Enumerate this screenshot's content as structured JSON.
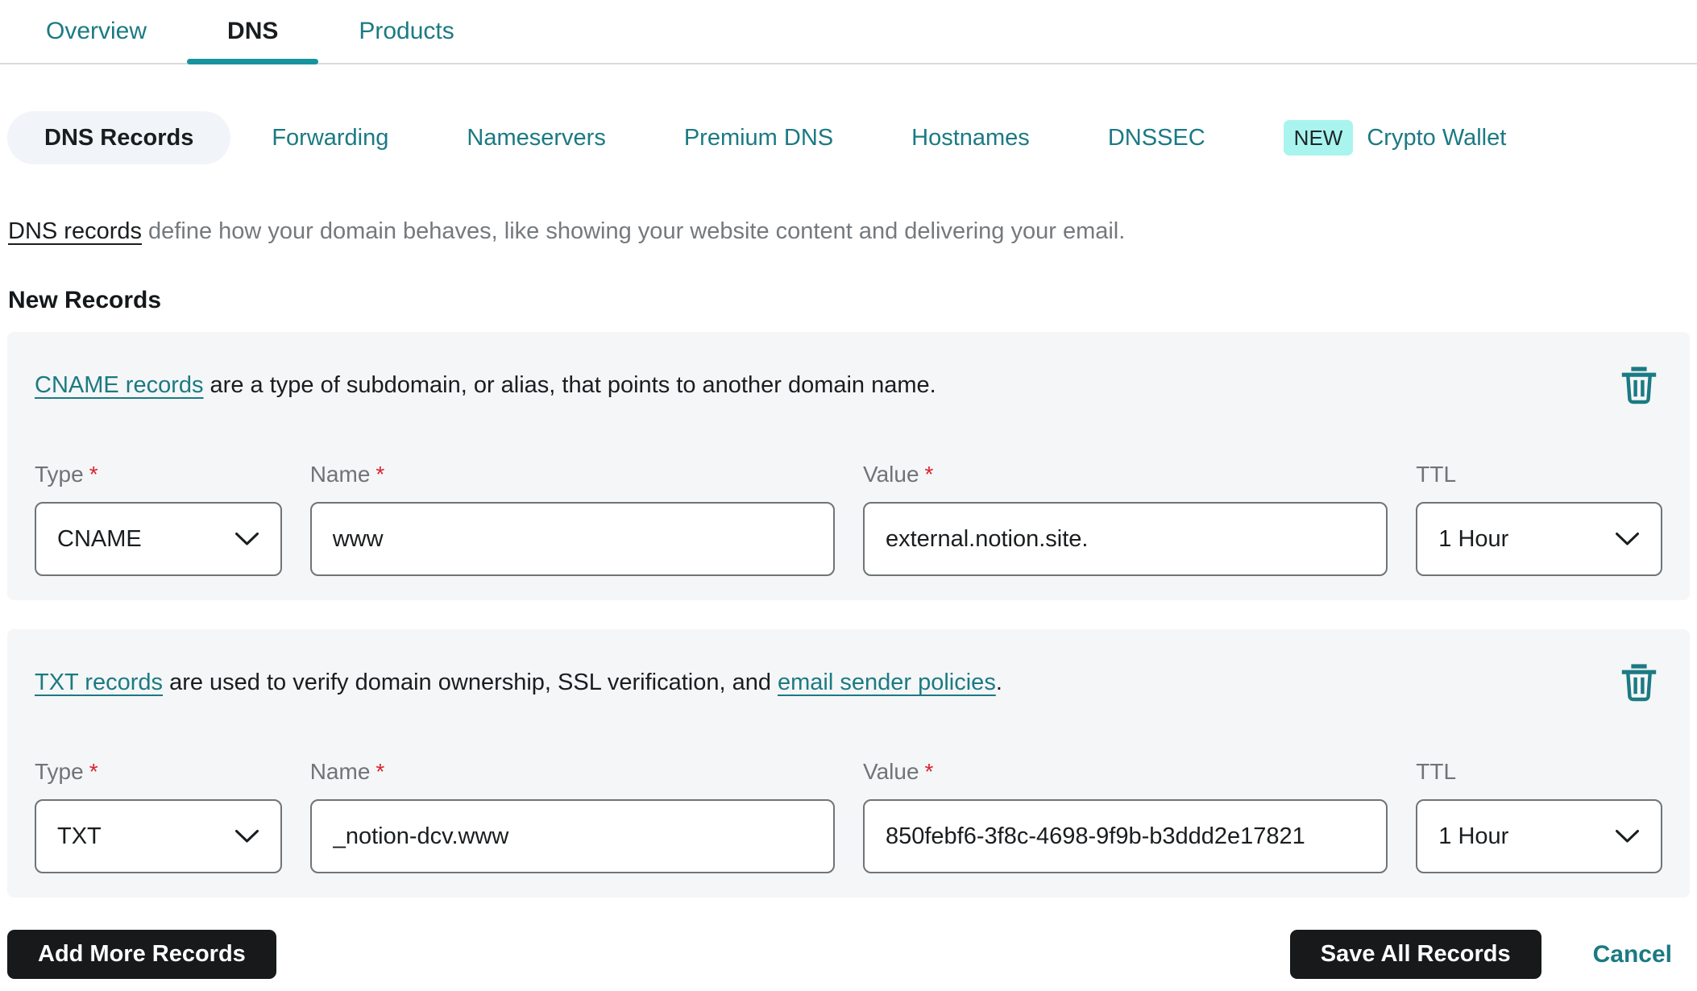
{
  "tabs": {
    "items": [
      {
        "label": "Overview",
        "active": false
      },
      {
        "label": "DNS",
        "active": true
      },
      {
        "label": "Products",
        "active": false
      }
    ]
  },
  "subtabs": {
    "items": [
      {
        "label": "DNS Records",
        "active": true
      },
      {
        "label": "Forwarding",
        "active": false
      },
      {
        "label": "Nameservers",
        "active": false
      },
      {
        "label": "Premium DNS",
        "active": false
      },
      {
        "label": "Hostnames",
        "active": false
      },
      {
        "label": "DNSSEC",
        "active": false
      },
      {
        "label": "Crypto Wallet",
        "active": false,
        "badge": "NEW"
      }
    ],
    "new_badge": "NEW"
  },
  "description": {
    "link_text": "DNS records",
    "rest_text": " define how your domain behaves, like showing your website content and delivering your email."
  },
  "section_title": "New Records",
  "field_labels": {
    "type": "Type",
    "name": "Name",
    "value": "Value",
    "ttl": "TTL",
    "required": "*"
  },
  "records": [
    {
      "intro_link": "CNAME records",
      "intro_text": " are a type of subdomain, or alias, that points to another domain name.",
      "intro_link2": "",
      "intro_text2": "",
      "type": "CNAME",
      "name": "www",
      "value": "external.notion.site.",
      "ttl": "1 Hour"
    },
    {
      "intro_link": "TXT records",
      "intro_text": " are used to verify domain ownership, SSL verification, and ",
      "intro_link2": "email sender policies",
      "intro_text2": ".",
      "type": "TXT",
      "name": "_notion-dcv.www",
      "value": "850febf6-3f8c-4698-9f9b-b3ddd2e17821",
      "ttl": "1 Hour"
    }
  ],
  "actions": {
    "add_more": "Add More Records",
    "save_all": "Save All Records",
    "cancel": "Cancel"
  },
  "colors": {
    "teal": "#1b7a83",
    "teal_underline": "#16939e",
    "new_badge_bg": "#a9f4ee",
    "card_bg": "#f5f6f7",
    "active_pill_bg": "#f1f4f9",
    "input_border": "#6f7477",
    "button_bg": "#17191a",
    "required_red": "#d9232e"
  }
}
